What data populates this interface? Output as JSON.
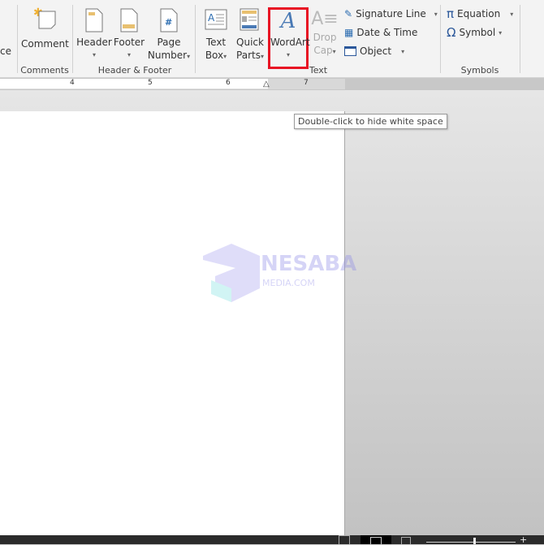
{
  "ribbon": {
    "partial_left": "ce",
    "comments": {
      "comment": "Comment",
      "group": "Comments"
    },
    "header_footer": {
      "header": "Header",
      "footer": "Footer",
      "page_number_1": "Page",
      "page_number_2": "Number",
      "group": "Header & Footer"
    },
    "text": {
      "text_box_1": "Text",
      "text_box_2": "Box",
      "quick_parts_1": "Quick",
      "quick_parts_2": "Parts",
      "wordart": "WordArt",
      "drop_cap_1": "Drop",
      "drop_cap_2": "Cap",
      "signature_line": "Signature Line",
      "date_time": "Date & Time",
      "object": "Object",
      "group": "Text"
    },
    "symbols": {
      "equation": "Equation",
      "symbol": "Symbol",
      "group": "Symbols"
    }
  },
  "ruler": {
    "marks": [
      "4",
      "5",
      "6",
      "7"
    ]
  },
  "tooltip": "Double-click to hide white space",
  "watermark": {
    "line1": "NESABA",
    "line2": "MEDIA.COM"
  },
  "colors": {
    "highlight": "#e81123",
    "accent": "#2b579a",
    "ribbon_bg": "#f3f3f3",
    "status_bg": "#2b2b2b"
  }
}
